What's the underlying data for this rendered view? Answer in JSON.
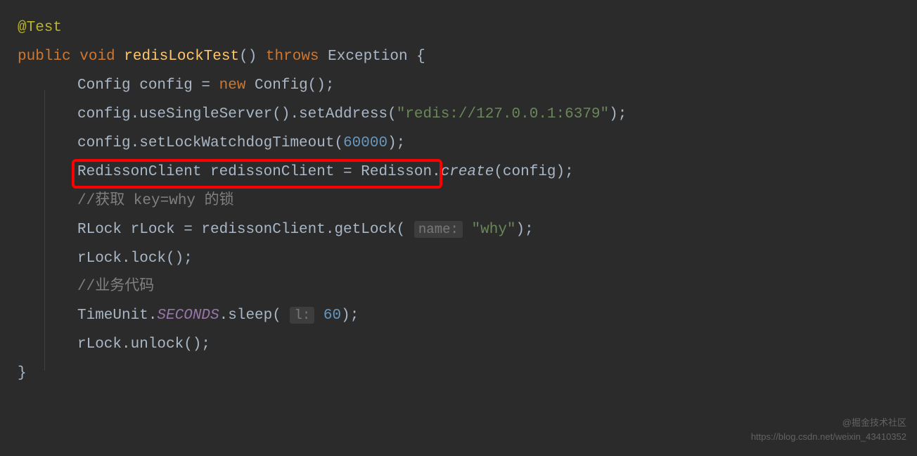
{
  "code": {
    "line1_annotation": "@Test",
    "line2_public": "public",
    "line2_void": "void",
    "line2_method": "redisLockTest",
    "line2_parens": "()",
    "line2_throws": "throws",
    "line2_exception": "Exception {",
    "line3_prefix": "Config config = ",
    "line3_new": "new",
    "line3_suffix": " Config();",
    "line4_prefix": "config.useSingleServer().setAddress(",
    "line4_string": "\"redis://127.0.0.1:6379\"",
    "line4_suffix": ");",
    "line5_prefix": "config.setLockWatchdogTimeout(",
    "line5_number": "60000",
    "line5_suffix": ");",
    "line6_prefix": "RedissonClient redissonClient = Redisson.",
    "line6_create": "create",
    "line6_suffix": "(config);",
    "line7_comment": "//获取 key=why 的锁",
    "line8_prefix": "RLock rLock = redissonClient.getLock( ",
    "line8_hint": "name:",
    "line8_space": " ",
    "line8_string": "\"why\"",
    "line8_suffix": ");",
    "line9": "rLock.lock();",
    "line10_comment": "//业务代码",
    "line11_prefix": "TimeUnit.",
    "line11_seconds": "SECONDS",
    "line11_mid": ".sleep( ",
    "line11_hint": "l:",
    "line11_space": " ",
    "line11_number": "60",
    "line11_suffix": ");",
    "line12": "rLock.unlock();",
    "line13_close": "}"
  },
  "watermark1": "@掘金技术社区",
  "watermark2": "https://blog.csdn.net/weixin_43410352"
}
